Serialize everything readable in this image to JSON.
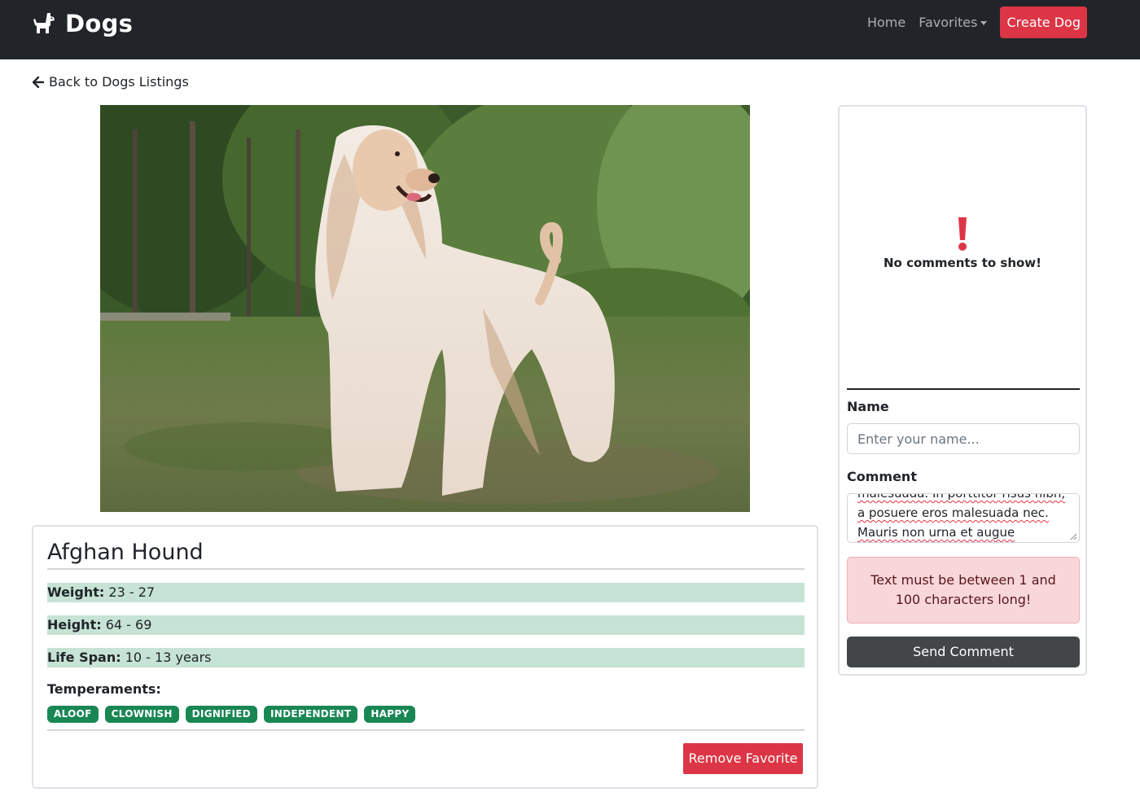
{
  "navbar": {
    "brand": "Dogs",
    "brand_icon": "dog-icon",
    "home": "Home",
    "favorites": "Favorites",
    "create": "Create Dog"
  },
  "back_link": {
    "label": "Back to Dogs Listings",
    "icon": "arrow-left-icon"
  },
  "image": {
    "subject": "photo of an Afghan Hound"
  },
  "dog": {
    "name": "Afghan Hound",
    "weight_label": "Weight:",
    "weight": "23 - 27",
    "height_label": "Height:",
    "height": "64 - 69",
    "lifespan_label": "Life Span:",
    "lifespan": "10 - 13 years",
    "temperaments_label": "Temperaments:",
    "temperaments": [
      "ALOOF",
      "CLOWNISH",
      "DIGNIFIED",
      "INDEPENDENT",
      "HAPPY"
    ],
    "remove_favorite": "Remove Favorite"
  },
  "comments": {
    "empty_icon": "exclamation-icon",
    "empty_text": "No comments to show!",
    "name_label": "Name",
    "name_placeholder": "Enter your name...",
    "comment_label": "Comment",
    "comment_value": "malesuada. In porttitor risus nibh, a posuere eros malesuada nec. Mauris non urna et augue porttitor.",
    "error": "Text must be between 1 and 100 characters long!",
    "send": "Send Comment"
  },
  "colors": {
    "navbar_bg": "#212529",
    "danger": "#dc3545",
    "success_badge": "#198754",
    "stat_bg": "#c6e3d5",
    "alert_bg": "#f8d7da",
    "send_bg": "#424649"
  }
}
